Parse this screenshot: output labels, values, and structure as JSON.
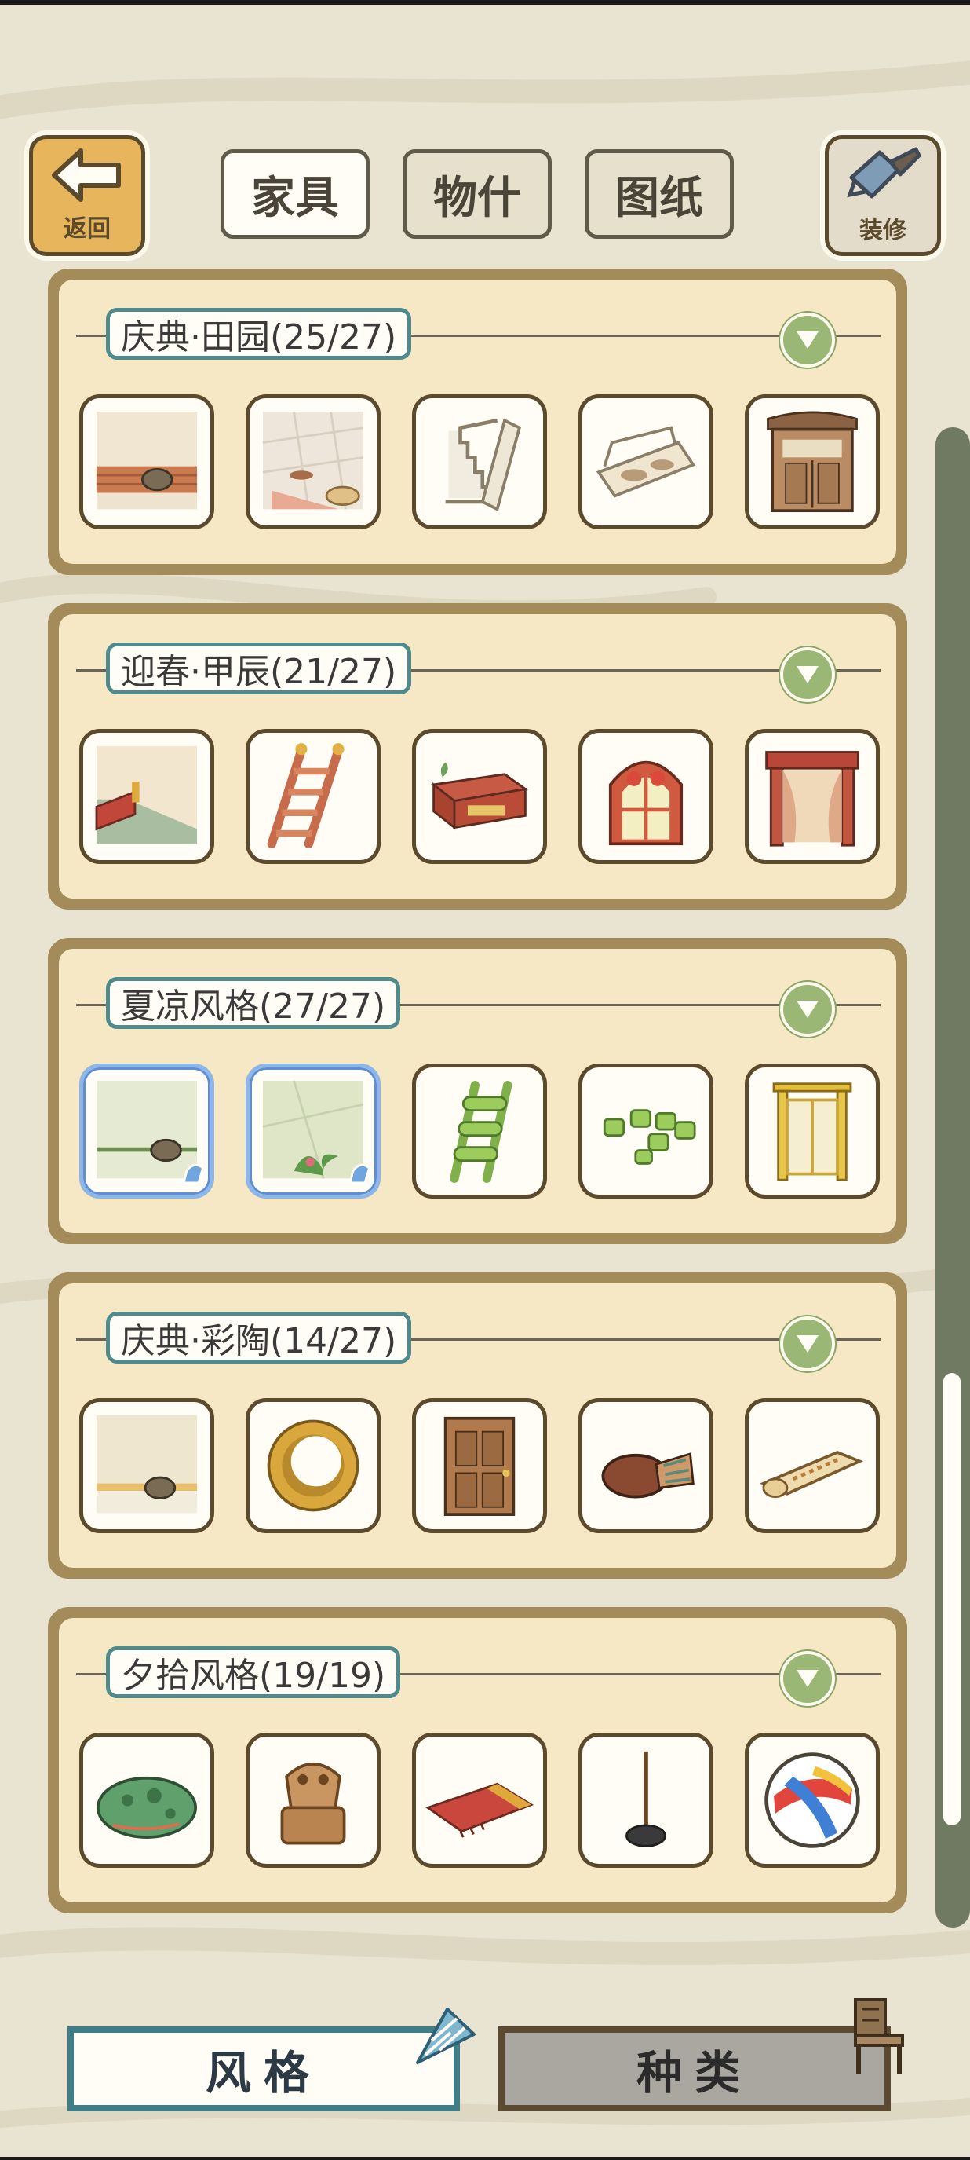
{
  "header": {
    "back_label": "返回",
    "decor_label": "装修",
    "tabs": [
      {
        "label": "家具",
        "active": true
      },
      {
        "label": "物什",
        "active": false
      },
      {
        "label": "图纸",
        "active": false
      }
    ]
  },
  "sections": [
    {
      "title": "庆典·田园(25/27)",
      "items": [
        "wallpaper-floor-set",
        "tile-floor-set",
        "white-stairs",
        "woven-bench",
        "wooden-cabinet"
      ]
    },
    {
      "title": "迎春·甲辰(21/27)",
      "items": [
        "green-floor-wall-set",
        "red-ladder",
        "red-bench",
        "arched-window",
        "red-doorway"
      ]
    },
    {
      "title": "夏凉风格(27/27)",
      "items": [
        "bamboo-wall-set",
        "leafy-floor-set",
        "bamboo-ladder",
        "bamboo-stools",
        "bamboo-door"
      ],
      "selected_items": [
        0,
        1
      ]
    },
    {
      "title": "庆典·彩陶(14/27)",
      "items": [
        "beige-wall-floor-set",
        "round-mirror",
        "wooden-door",
        "pottery-vase",
        "rolled-rug"
      ]
    },
    {
      "title": "夕拾风格(19/19)",
      "items": [
        "frog-rock",
        "frog-statue",
        "red-rug",
        "standing-lamp",
        "striped-ball"
      ]
    }
  ],
  "bottom": {
    "style_label": "风格",
    "kind_label": "种类"
  },
  "colors": {
    "background": "#e9e4d1",
    "panel_frame": "#a48c5a",
    "panel_fill": "#f6e8c4",
    "title_border": "#4f8a8c",
    "toggle": "#9bb775",
    "item_border": "#5c4a2c",
    "selected_border": "#8fb6e8"
  }
}
